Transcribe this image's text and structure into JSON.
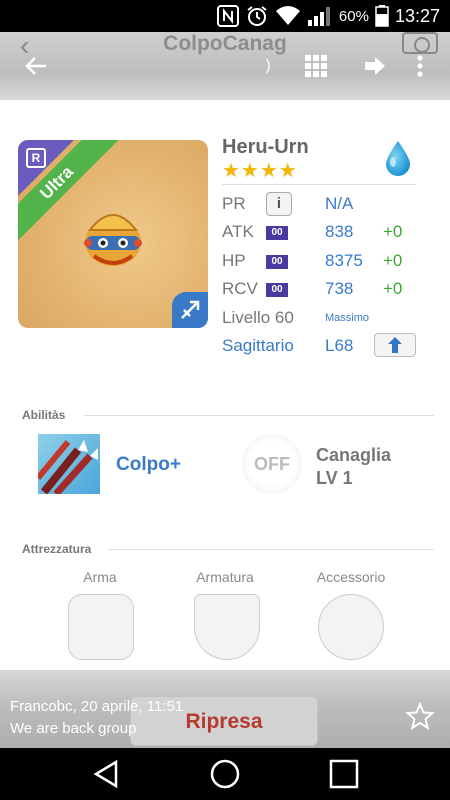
{
  "status_bar": {
    "battery_percent": "60%",
    "time": "13:27"
  },
  "toolbar": {
    "title": "ColpoCanag"
  },
  "monster": {
    "name": "Heru-Urn",
    "rarity_label": "Ultra",
    "stars": "★★★★",
    "stats": {
      "pr": {
        "label": "PR",
        "value": "N/A",
        "info": "i"
      },
      "atk": {
        "label": "ATK",
        "tag": "00",
        "value": "838",
        "plus": "+0"
      },
      "hp": {
        "label": "HP",
        "tag": "00",
        "value": "8375",
        "plus": "+0"
      },
      "rcv": {
        "label": "RCV",
        "tag": "00",
        "value": "738",
        "plus": "+0"
      }
    },
    "level": {
      "label": "Livello 60",
      "max": "Massimo"
    },
    "constellation": {
      "label": "Sagittario",
      "level": "L68"
    }
  },
  "abilities": {
    "section_title": "Abilitàs",
    "skill_name": "Colpo+",
    "leader_off": "OFF",
    "leader_name": "Canaglia",
    "leader_level": "LV 1"
  },
  "equipment": {
    "section_title": "Attrezzatura",
    "slots": [
      "Arma",
      "Armatura",
      "Accessorio"
    ]
  },
  "notification": {
    "button": "Ripresa",
    "author_time": "Francobc, 20 aprile, 11:51",
    "group": "We are back group"
  },
  "colors": {
    "accent_blue": "#3a7bc8",
    "bonus_green": "#3ea63a",
    "ultra_green": "#51b34a",
    "rarity_purple": "#6b5bbf"
  }
}
